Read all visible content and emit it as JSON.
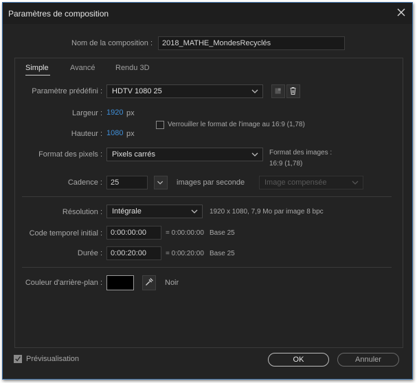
{
  "window": {
    "title": "Paramètres de composition"
  },
  "name_field": {
    "label": "Nom de la composition :",
    "value": "2018_MATHE_MondesRecyclés"
  },
  "tabs": [
    {
      "label": "Simple"
    },
    {
      "label": "Avancé"
    },
    {
      "label": "Rendu 3D"
    }
  ],
  "preset": {
    "label": "Paramètre prédéfini :",
    "value": "HDTV 1080 25"
  },
  "width": {
    "label": "Largeur :",
    "value": "1920",
    "unit": "px"
  },
  "height": {
    "label": "Hauteur :",
    "value": "1080",
    "unit": "px"
  },
  "lock_aspect": {
    "label": "Verrouiller le format de l'image au 16:9 (1,78)",
    "checked": false
  },
  "pixel_format": {
    "label": "Format des pixels :",
    "value": "Pixels carrés"
  },
  "frame_format": {
    "label": "Format des images :",
    "value": "16:9 (1,78)"
  },
  "frame_rate": {
    "label": "Cadence :",
    "value": "25",
    "unit": "images par seconde",
    "mode": "Image compensée"
  },
  "resolution": {
    "label": "Résolution :",
    "value": "Intégrale",
    "info": "1920 x 1080, 7,9 Mo par image 8 bpc"
  },
  "start_timecode": {
    "label": "Code temporel initial :",
    "value": "0:00:00:00",
    "equals": "= 0:00:00:00",
    "base": "Base 25"
  },
  "duration": {
    "label": "Durée :",
    "value": "0:00:20:00",
    "equals": "= 0:00:20:00",
    "base": "Base 25"
  },
  "background": {
    "label": "Couleur d'arrière-plan :",
    "color": "#000000",
    "color_name": "Noir"
  },
  "preview": {
    "label": "Prévisualisation",
    "checked": true
  },
  "buttons": {
    "ok": "OK",
    "cancel": "Annuler"
  },
  "colors": {
    "accent_blue": "#3f8fd9",
    "window_bg": "#232323",
    "title_bg": "#1e1e1e"
  }
}
